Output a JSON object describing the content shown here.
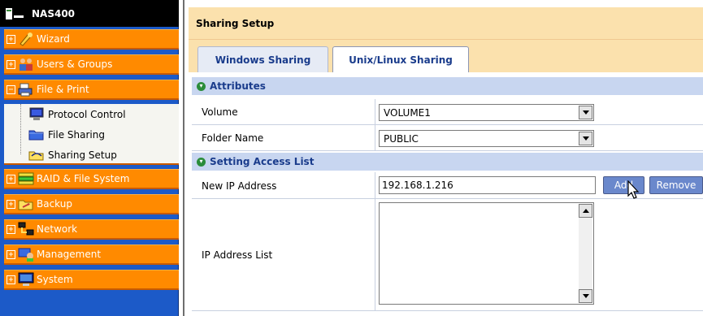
{
  "sidebar": {
    "title": "NAS400",
    "items": [
      {
        "label": "Wizard"
      },
      {
        "label": "Users & Groups"
      },
      {
        "label": "File & Print"
      },
      {
        "label": "RAID & File System"
      },
      {
        "label": "Backup"
      },
      {
        "label": "Network"
      },
      {
        "label": "Management"
      },
      {
        "label": "System"
      }
    ],
    "sub_items": [
      {
        "label": "Protocol Control"
      },
      {
        "label": "File Sharing"
      },
      {
        "label": "Sharing Setup"
      }
    ]
  },
  "main": {
    "header": "Sharing Setup",
    "tabs": [
      {
        "label": "Windows Sharing"
      },
      {
        "label": "Unix/Linux Sharing"
      }
    ],
    "sections": {
      "attributes": "Attributes",
      "access": "Setting Access List"
    },
    "fields": {
      "volume_label": "Volume",
      "volume_value": "VOLUME1",
      "folder_label": "Folder Name",
      "folder_value": "PUBLIC",
      "ip_label": "New IP Address",
      "ip_value": "192.168.1.216",
      "list_label": "IP Address List"
    },
    "buttons": {
      "add": "Add",
      "remove": "Remove"
    }
  },
  "colors": {
    "sidebar_bg": "#1c5ac8",
    "menu_orange": "#ff8a00",
    "header_bg": "#fbe1ad",
    "section_bg": "#c8d6f0",
    "button_bg": "#6a88cc"
  }
}
